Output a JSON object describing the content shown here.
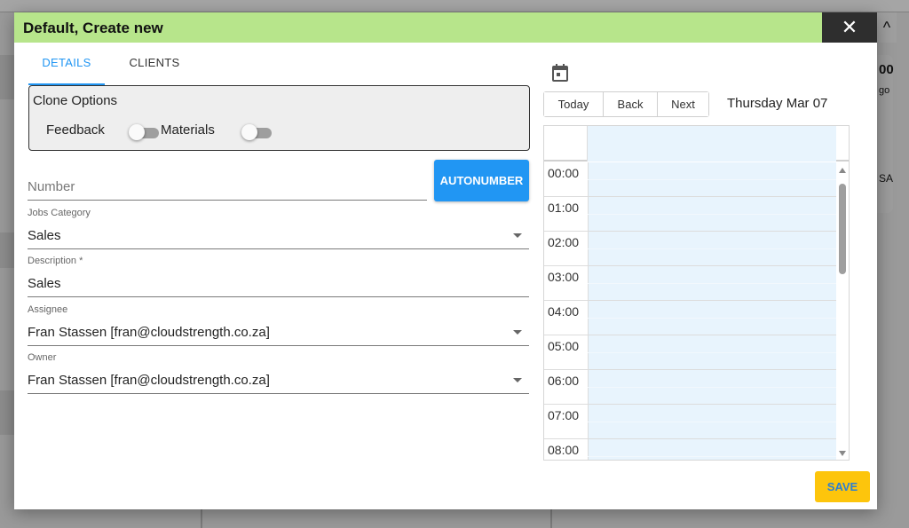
{
  "background": {
    "right_card_line1": "00",
    "right_card_line2": "go",
    "right_card_line3": "SA",
    "caret": "^"
  },
  "modal": {
    "title": "Default, Create new",
    "close_symbol": "✕",
    "header_color": "#b7e58b"
  },
  "tabs": [
    {
      "label": "DETAILS",
      "active": true
    },
    {
      "label": "CLIENTS",
      "active": false
    }
  ],
  "clone_options": {
    "title": "Clone Options",
    "feedback_label": "Feedback",
    "feedback_on": false,
    "materials_label": "Materials",
    "materials_on": false
  },
  "form": {
    "number_placeholder": "Number",
    "autonumber_label": "AUTONUMBER",
    "jobs_category": {
      "label": "Jobs Category",
      "value": "Sales"
    },
    "description": {
      "label": "Description *",
      "value": "Sales"
    },
    "assignee": {
      "label": "Assignee",
      "value": "Fran Stassen [fran@cloudstrength.co.za]"
    },
    "owner": {
      "label": "Owner",
      "value": "Fran Stassen [fran@cloudstrength.co.za]"
    }
  },
  "calendar": {
    "icon": "calendar-icon",
    "today_label": "Today",
    "back_label": "Back",
    "next_label": "Next",
    "current_date": "Thursday Mar 07",
    "hours": [
      "00:00",
      "01:00",
      "02:00",
      "03:00",
      "04:00",
      "05:00",
      "06:00",
      "07:00",
      "08:00"
    ],
    "slot_color": "#e8f4fd"
  },
  "actions": {
    "save_label": "SAVE",
    "save_color": "#fdc50c"
  }
}
